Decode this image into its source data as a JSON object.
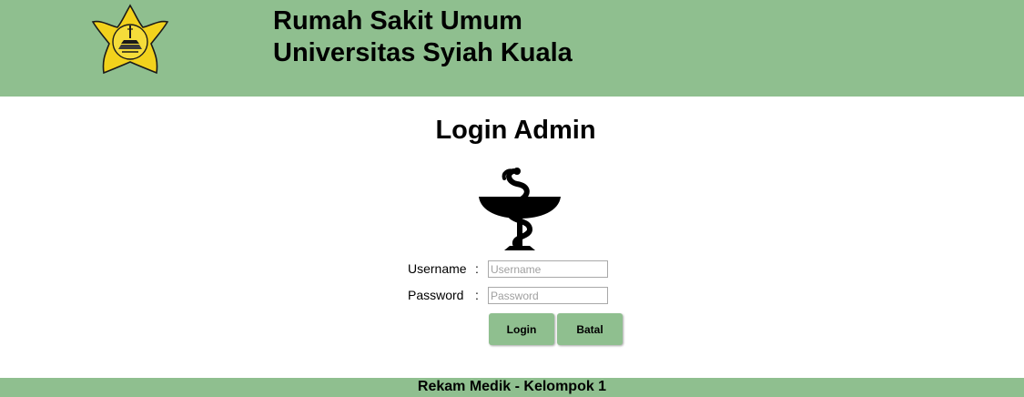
{
  "header": {
    "title_line1": "Rumah Sakit Umum",
    "title_line2": "Universitas Syiah Kuala",
    "logo_icon": "university-star-logo",
    "background_color": "#8fbf8f"
  },
  "login": {
    "title": "Login Admin",
    "emblem_icon": "bowl-of-hygieia-icon",
    "username_label": "Username",
    "username_placeholder": "Username",
    "username_value": "",
    "password_label": "Password",
    "password_placeholder": "Password",
    "password_value": "",
    "separator": ":",
    "login_button": "Login",
    "cancel_button": "Batal"
  },
  "footer": {
    "text": "Rekam Medik - Kelompok 1"
  }
}
